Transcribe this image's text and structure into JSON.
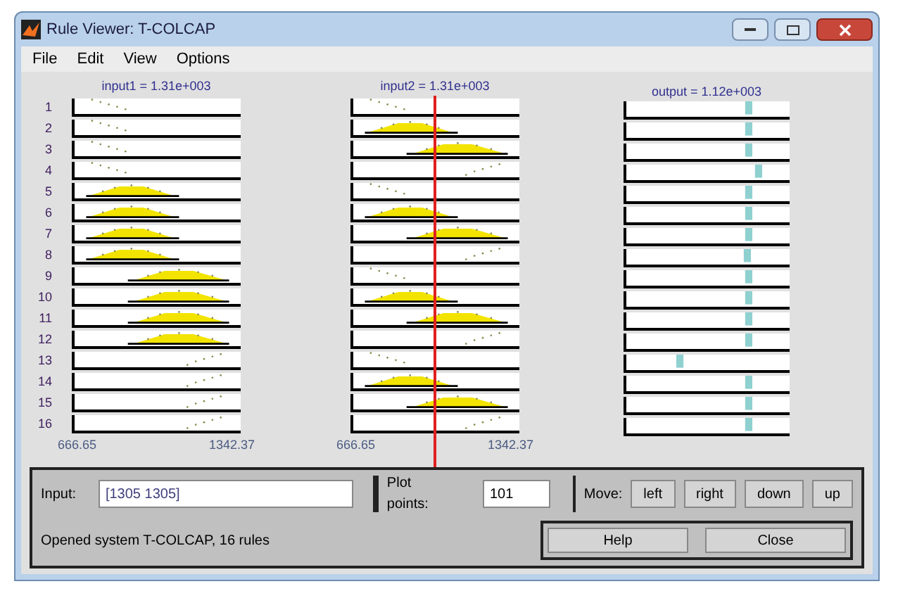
{
  "window": {
    "title": "Rule Viewer: T-COLCAP"
  },
  "menu": [
    "File",
    "Edit",
    "View",
    "Options"
  ],
  "plots": {
    "input1_label": "input1 = 1.31e+003",
    "input2_label": "input2 = 1.31e+003",
    "output_label": "output = 1.12e+003",
    "rules": [
      "1",
      "2",
      "3",
      "4",
      "5",
      "6",
      "7",
      "8",
      "9",
      "10",
      "11",
      "12",
      "13",
      "14",
      "15",
      "16"
    ],
    "input1_ticks": [
      "666.65",
      "1342.37"
    ],
    "input2_ticks": [
      "666.65",
      "1342.37"
    ]
  },
  "input": {
    "label": "Input:",
    "value": "[1305 1305]"
  },
  "plot_points": {
    "label": "Plot points:",
    "value": "101"
  },
  "move": {
    "label": "Move:",
    "buttons": [
      "left",
      "right",
      "down",
      "up"
    ]
  },
  "status": "Opened system T-COLCAP, 16 rules",
  "buttons": [
    "Help",
    "Close"
  ]
}
